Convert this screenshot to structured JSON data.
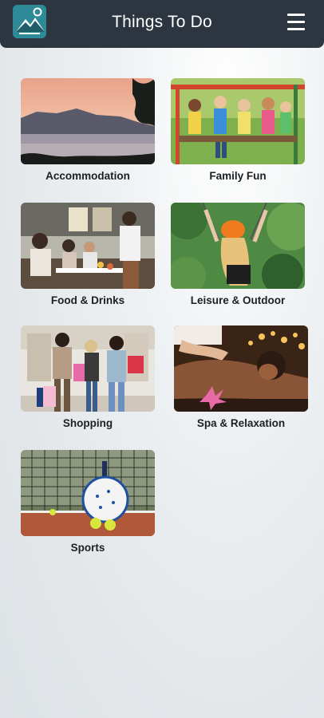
{
  "header": {
    "title": "Things To Do",
    "logo_icon": "mountain-logo-icon",
    "menu_icon": "hamburger-menu-icon",
    "background": "#2d3640"
  },
  "categories": [
    {
      "label": "Accommodation",
      "image": "lake-sunset-photo"
    },
    {
      "label": "Family Fun",
      "image": "kids-on-swing-photo"
    },
    {
      "label": "Food & Drinks",
      "image": "outdoor-dining-photo"
    },
    {
      "label": "Leisure & Outdoor",
      "image": "zipline-photo"
    },
    {
      "label": "Shopping",
      "image": "shopping-mall-photo"
    },
    {
      "label": "Spa & Relaxation",
      "image": "massage-photo"
    },
    {
      "label": "Sports",
      "image": "padel-tennis-photo"
    }
  ]
}
